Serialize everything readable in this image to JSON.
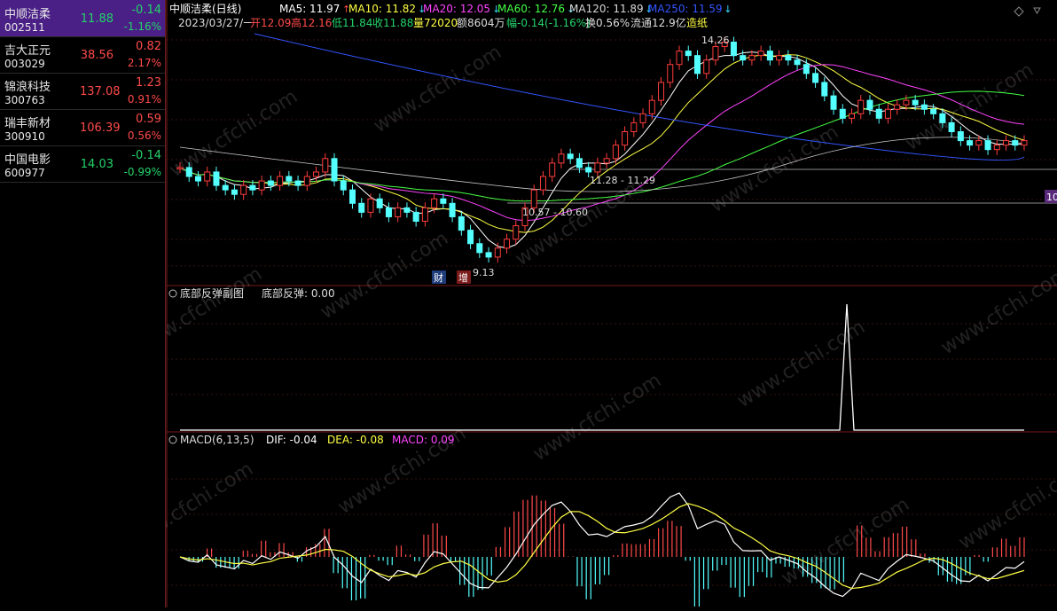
{
  "watchlist": [
    {
      "name": "中顺洁柔",
      "code": "002511",
      "price": "11.88",
      "change": "-0.14",
      "pct": "-1.16%",
      "dir": "dn",
      "selected": true
    },
    {
      "name": "吉大正元",
      "code": "003029",
      "price": "38.56",
      "change": "0.82",
      "pct": "2.17%",
      "dir": "up",
      "selected": false
    },
    {
      "name": "锦浪科技",
      "code": "300763",
      "price": "137.08",
      "change": "1.23",
      "pct": "0.91%",
      "dir": "up",
      "selected": false
    },
    {
      "name": "瑞丰新材",
      "code": "300910",
      "price": "106.39",
      "change": "0.59",
      "pct": "0.56%",
      "dir": "up",
      "selected": false
    },
    {
      "name": "中国电影",
      "code": "600977",
      "price": "14.03",
      "change": "-0.14",
      "pct": "-0.99%",
      "dir": "dn",
      "selected": false
    }
  ],
  "main": {
    "title": "中顺洁柔(日线)",
    "ma": [
      {
        "label": "MA5: 11.97",
        "color": "#ffffff"
      },
      {
        "label": "MA10: 11.82",
        "color": "#ffff44"
      },
      {
        "label": "MA20: 12.05",
        "color": "#ff44ff"
      },
      {
        "label": "MA60: 12.76",
        "color": "#44ff44"
      },
      {
        "label": "MA120: 11.89",
        "color": "#d8d8d8"
      },
      {
        "label": "MA250: 11.59",
        "color": "#3355ff"
      }
    ],
    "info": {
      "date": "2023/03/27/一",
      "open": "开12.09",
      "high": "高12.16",
      "low": "低11.84",
      "close": "收11.88",
      "vol": "量72020",
      "amount": "额8604万",
      "amp": "幅-0.14(-1.16%)",
      "turnover": "换0.56%",
      "float": "流通12.9亿",
      "sector": "造纸"
    },
    "annotations": {
      "high": "14.26",
      "low": "9.13",
      "lvl1": "11.28 - 11.29",
      "lvl2": "10.57 - 10.60",
      "tag_cai": "财",
      "tag_zeng": "增",
      "right_edge": "10"
    }
  },
  "sub1": {
    "title": "底部反弹副图",
    "label": "底部反弹: 0.00"
  },
  "macd": {
    "title": "MACD(6,13,5)",
    "dif": "DIF: -0.04",
    "dea": "DEA: -0.08",
    "macd": "MACD: 0.09"
  },
  "watermark": "www.cfchi.com",
  "colors": {
    "up": "#ff4a4a",
    "down": "#23d46a",
    "frame": "#7a1a1a",
    "candle_down": "#54ffff",
    "candle_up": "#ff3c3c"
  }
}
